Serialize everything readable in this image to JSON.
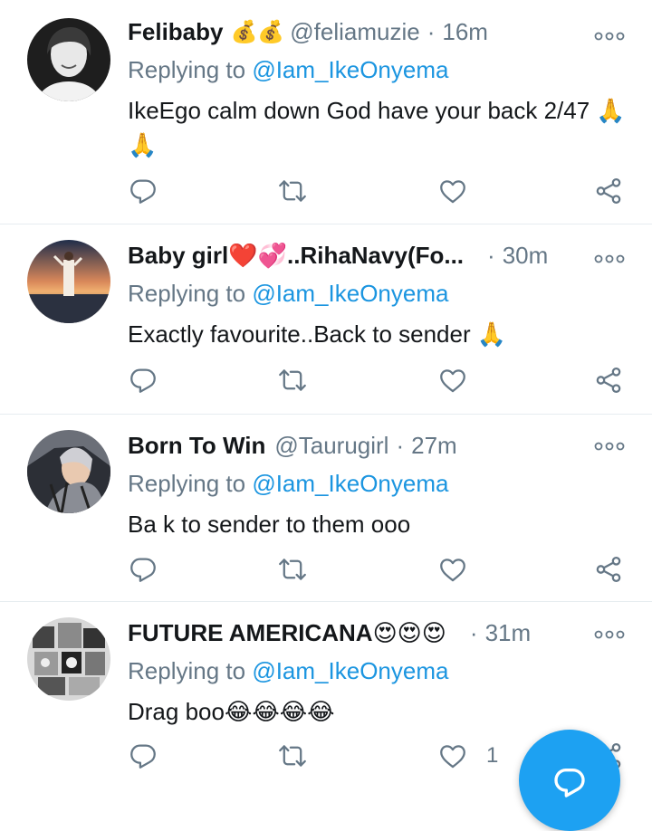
{
  "tweets": [
    {
      "name": "Felibaby",
      "name_emoji": "💰💰",
      "handle": "@feliamuzie",
      "time": "16m",
      "replying_prefix": "Replying to ",
      "replying_to": "@Iam_IkeOnyema",
      "text": "IkeEgo calm down God have your back 2/47 🙏🙏",
      "like_count": ""
    },
    {
      "name": "Baby girl❤️💞..RihaNavy(Fo...",
      "name_emoji": "",
      "handle": "",
      "time": "30m",
      "replying_prefix": "Replying to ",
      "replying_to": "@Iam_IkeOnyema",
      "text": "Exactly favourite..Back to sender 🙏",
      "like_count": ""
    },
    {
      "name": "Born To Win",
      "name_emoji": "",
      "handle": "@Taurugirl",
      "time": "27m",
      "replying_prefix": "Replying to ",
      "replying_to": "@Iam_IkeOnyema",
      "text": "Ba k to sender to them ooo",
      "like_count": ""
    },
    {
      "name": "FUTURE AMERICANA😍😍😍",
      "name_emoji": "",
      "handle": "",
      "time": "31m",
      "replying_prefix": "Replying to ",
      "replying_to": "@Iam_IkeOnyema",
      "text": "Drag boo😂😂😂😂",
      "like_count": "1"
    }
  ],
  "icons": {
    "more": "more-options-icon",
    "reply": "reply-icon",
    "retweet": "retweet-icon",
    "like": "heart-icon",
    "share": "share-icon",
    "compose": "compose-icon"
  },
  "colors": {
    "link": "#1b95e0",
    "muted": "#657786",
    "text": "#14171a",
    "fab": "#1da1f2",
    "divider": "#e6ecf0"
  }
}
